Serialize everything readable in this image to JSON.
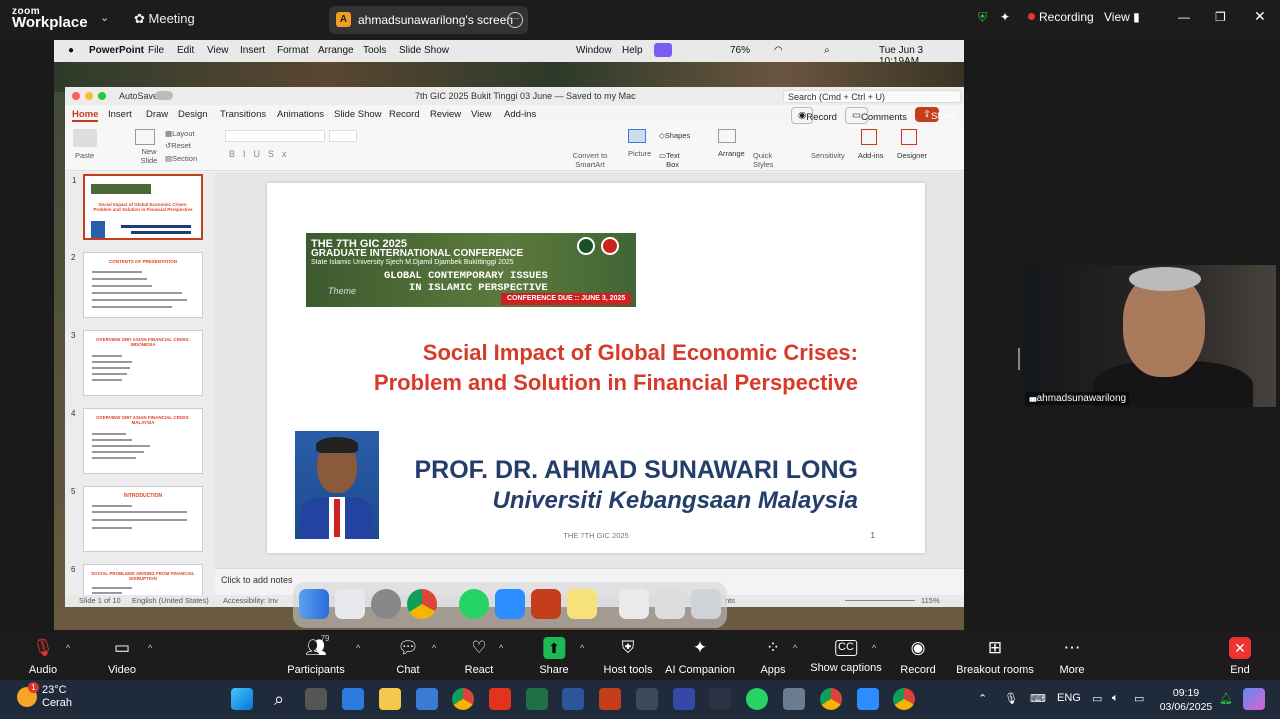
{
  "zoom_bar": {
    "brand_line1": "zoom",
    "brand_line2": "Workplace",
    "meeting_label": "Meeting",
    "screen_pill": {
      "initial": "A",
      "text": "ahmadsunawarilong's screen"
    },
    "recording": "Recording",
    "view": "View"
  },
  "mac_menu": {
    "app": "PowerPoint",
    "items": [
      "File",
      "Edit",
      "View",
      "Insert",
      "Format",
      "Arrange",
      "Tools",
      "Slide Show",
      "Window",
      "Help"
    ],
    "battery": "76%",
    "datetime": "Tue Jun 3  10:19AM"
  },
  "ppt": {
    "autosave": "AutoSave",
    "doc_title": "7th GIC 2025 Bukit Tinggi 03 June — Saved to my Mac",
    "search_placeholder": "Search (Cmd + Ctrl + U)",
    "tabs": [
      "Home",
      "Insert",
      "Draw",
      "Design",
      "Transitions",
      "Animations",
      "Slide Show",
      "Record",
      "Review",
      "View",
      "Add-ins"
    ],
    "record_btn": "Record",
    "comments_btn": "Comments",
    "share_btn": "Share",
    "ribbon": {
      "paste": "Paste",
      "new_slide": "New Slide",
      "layout": "Layout",
      "reset": "Reset",
      "section": "Section",
      "convert": "Convert to SmartArt",
      "picture": "Picture",
      "shapes": "Shapes",
      "text_box": "Text Box",
      "arrange": "Arrange",
      "quick_styles": "Quick Styles",
      "sensitivity": "Sensitivity",
      "addins": "Add-ins",
      "designer": "Designer"
    },
    "thumbs": [
      {
        "n": "1",
        "title": "Social Impact of Global Economic Crises: Problem and Solution in Financial Perspective",
        "lines": 2
      },
      {
        "n": "2",
        "title": "CONTENTS OF PRESENTATION",
        "lines": 6
      },
      {
        "n": "3",
        "title": "OVERVIEW 1997 ASIAN FINANCIAL CRISIS: INDONESIA",
        "lines": 5
      },
      {
        "n": "4",
        "title": "OVERVIEW 1997 ASIAN FINANCIAL CRISIS: MALAYSIA",
        "lines": 5
      },
      {
        "n": "5",
        "title": "INTRODUCTION",
        "lines": 4
      },
      {
        "n": "6",
        "title": "SOCIAL PROBLEMS ARISING FROM FINANCIAL DISRUPTION",
        "lines": 2
      }
    ],
    "slide": {
      "banner_line1": "THE 7TH GIC 2025",
      "banner_line2": "GRADUATE INTERNATIONAL CONFERENCE",
      "banner_line3": "State Islamic University Sjech M.Djamil Djambek Bukittinggi 2025",
      "banner_line4": "GLOBAL CONTEMPORARY ISSUES",
      "banner_line5": "IN ISLAMIC PERSPECTIVE",
      "banner_theme": "Theme",
      "banner_date": "CONFERENCE DUE :: JUNE 3, 2025",
      "title_line1": "Social Impact of Global Economic Crises:",
      "title_line2": "Problem and Solution in Financial Perspective",
      "author": "PROF. DR. AHMAD SUNAWARI LONG",
      "university": "Universiti Kebangsaan Malaysia",
      "footer": "THE 7TH GIC 2025",
      "number": "1"
    },
    "notes_placeholder": "Click to add notes",
    "status": {
      "slide_of": "Slide 1 of 10",
      "language": "English (United States)",
      "accessibility": "Accessibility: Inv",
      "notes": "nts",
      "zoom": "115%"
    }
  },
  "participant": {
    "name": "ahmadsunawarilong"
  },
  "controls": [
    {
      "label": "Audio",
      "icon": "mic-muted-icon",
      "caret": true
    },
    {
      "label": "Video",
      "icon": "video-icon",
      "caret": true
    },
    {
      "label": "Participants",
      "icon": "participants-icon",
      "count": "79",
      "caret": true
    },
    {
      "label": "Chat",
      "icon": "chat-icon",
      "caret": true
    },
    {
      "label": "React",
      "icon": "react-icon",
      "caret": true
    },
    {
      "label": "Share",
      "icon": "share-icon",
      "caret": true
    },
    {
      "label": "Host tools",
      "icon": "shield-icon"
    },
    {
      "label": "AI Companion",
      "icon": "sparkle-icon"
    },
    {
      "label": "Apps",
      "icon": "apps-icon",
      "caret": true
    },
    {
      "label": "Show captions",
      "icon": "cc-icon",
      "caret": true
    },
    {
      "label": "Record",
      "icon": "record-icon"
    },
    {
      "label": "Breakout rooms",
      "icon": "breakout-icon"
    },
    {
      "label": "More",
      "icon": "more-icon"
    },
    {
      "label": "End",
      "icon": "end-icon"
    }
  ],
  "taskbar": {
    "weather_temp": "23°C",
    "weather_desc": "Cerah",
    "weather_badge": "1",
    "lang": "ENG",
    "time": "09:19",
    "date": "03/06/2025"
  }
}
